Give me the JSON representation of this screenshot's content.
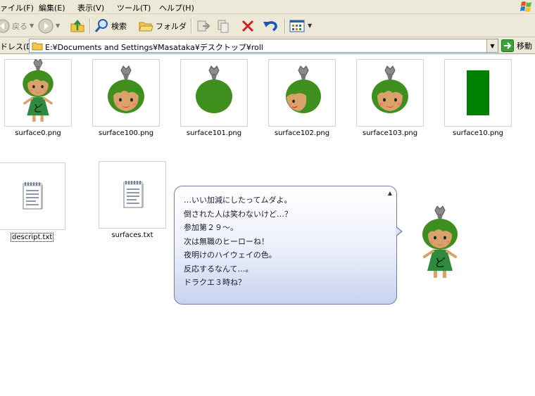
{
  "menu": {
    "items": [
      "ァイル(F)",
      "編集(E)",
      "表示(V)",
      "ツール(T)",
      "ヘルプ(H)"
    ]
  },
  "toolbar": {
    "back_label": "戻る",
    "search_label": "検索",
    "folders_label": "フォルダ"
  },
  "address": {
    "label": "ドレス(D)",
    "path": "E:¥Documents and Settings¥Masataka¥デスクトップ¥roll",
    "go_label": "移動"
  },
  "files": [
    {
      "name": "surface0.png",
      "kind": "full"
    },
    {
      "name": "surface100.png",
      "kind": "head"
    },
    {
      "name": "surface101.png",
      "kind": "head-back"
    },
    {
      "name": "surface102.png",
      "kind": "head-side"
    },
    {
      "name": "surface103.png",
      "kind": "head"
    },
    {
      "name": "surface10.png",
      "kind": "green-rect"
    },
    {
      "name": "descript.txt",
      "kind": "text"
    },
    {
      "name": "surfaces.txt",
      "kind": "text"
    }
  ],
  "balloon": {
    "lines": [
      "…いい加減にしたってムダよ。",
      "倒された人は笑わないけど…？",
      "参加第２９～。",
      "次は無職のヒーローね！",
      "夜明けのハイウェイの色。",
      "反応するなんて…。",
      "ドラクエ３時ね？"
    ]
  },
  "colors": {
    "chrome": "#ece9d8",
    "hair_green": "#3f8f1f",
    "dress_green": "#2e8b3e",
    "skin": "#d8a26a",
    "balloon_border": "#6f7fa8"
  }
}
